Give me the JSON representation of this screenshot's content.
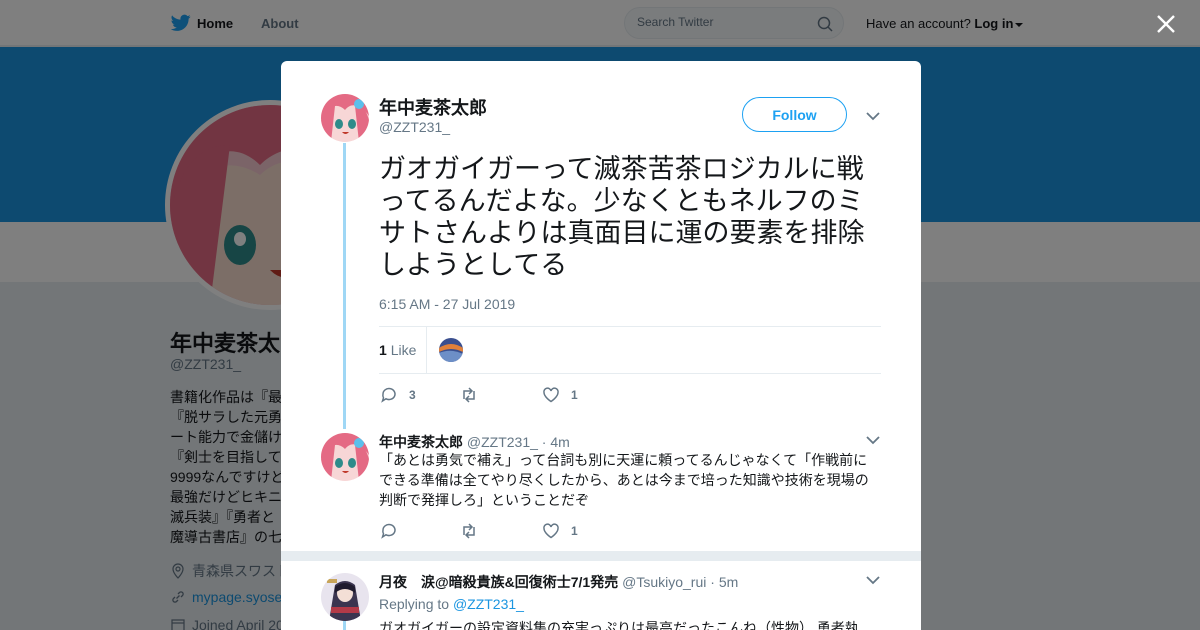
{
  "nav": {
    "home_label": "Home",
    "about_label": "About",
    "search_placeholder": "Search Twitter",
    "account_prompt": "Have an account?",
    "login_label": "Log in"
  },
  "profile": {
    "name": "年中麦茶太郎",
    "handle": "@ZZT231_",
    "bio": "書籍化作品は『最\n『脱サラした元勇\nート能力で金儲け\n『剣士を目指して\n9999なんですけど\n最強だけどヒキニ\n滅兵装』『勇者と\n魔導古書店』の七",
    "location": "青森県スワスト",
    "website": "mypage.syose",
    "joined": "Joined April 20"
  },
  "tweet": {
    "author_name": "年中麦茶太郎",
    "author_handle": "@ZZT231_",
    "follow_label": "Follow",
    "text": "ガオガイガーって滅茶苦茶ロジカルに戦ってるんだよな。少なくともネルフのミサトさんよりは真面目に運の要素を排除しようとしてる",
    "timestamp": "6:15 AM - 27 Jul 2019",
    "like_count": "1",
    "like_label": "Like",
    "reply_count": "3",
    "retweet_count": "",
    "favorite_count": "1"
  },
  "replies": [
    {
      "author_name": "年中麦茶太郎",
      "author_handle": "@ZZT231_",
      "time": "· 4m",
      "text": "「あとは勇気で補え」って台詞も別に天運に頼ってるんじゃなくて「作戦前にできる準備は全てやり尽くしたから、あとは今まで培った知識や技術を現場の判断で発揮しろ」ということだぞ",
      "reply_count": "",
      "retweet_count": "",
      "like_count": "1"
    },
    {
      "author_name": "月夜　涙@暗殺貴族&回復術士7/1発売",
      "author_handle": "@Tsukiyo_rui",
      "time": "· 5m",
      "replying_prefix": "Replying to",
      "replying_to": "@ZZT231_",
      "text": "ガオガイガーの設定資料集の充実っぷりは最高だったこんね（性物） 勇者執"
    }
  ],
  "colors": {
    "accent": "#1da1f2",
    "banner": "#1b95e0",
    "thread_line": "#9fd7f5",
    "muted_text": "#657786"
  }
}
